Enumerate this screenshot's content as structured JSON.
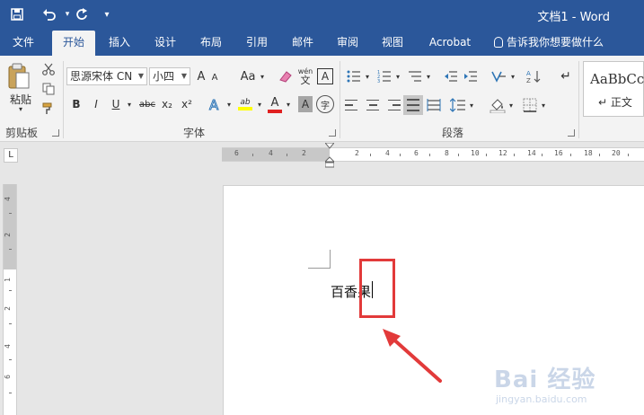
{
  "window": {
    "title": "文档1  -  Word"
  },
  "quick_access": {
    "save_icon": "save-icon",
    "undo_icon": "undo-icon",
    "redo_icon": "redo-icon",
    "customize": "▾"
  },
  "tabs": [
    {
      "label": "文件"
    },
    {
      "label": "开始",
      "active": true
    },
    {
      "label": "插入"
    },
    {
      "label": "设计"
    },
    {
      "label": "布局"
    },
    {
      "label": "引用"
    },
    {
      "label": "邮件"
    },
    {
      "label": "审阅"
    },
    {
      "label": "视图"
    },
    {
      "label": "Acrobat"
    }
  ],
  "tell_me": {
    "label": "告诉我你想要做什么"
  },
  "clipboard": {
    "paste_label": "粘贴",
    "group_label": "剪贴板"
  },
  "font": {
    "name": "思源宋体 CN",
    "size": "小四",
    "group_label": "字体",
    "buttons": {
      "bold": "B",
      "italic": "I",
      "underline": "U",
      "strike": "abc",
      "subscript": "x₂",
      "superscript": "x²",
      "change_case": "Aa",
      "grow": "A",
      "shrink": "A",
      "phonetic": "wén",
      "phonetic_char": "文",
      "char_border": "A",
      "highlight_label": "ab",
      "font_color": "A",
      "char_shading": "A",
      "enclose": "字"
    }
  },
  "paragraph": {
    "group_label": "段落"
  },
  "styles": {
    "sample": "AaBbCcD",
    "name": "↵ 正文"
  },
  "ruler": {
    "h_numbers": [
      "6",
      "4",
      "2",
      "2",
      "4",
      "6",
      "8",
      "10",
      "12",
      "14",
      "16",
      "18",
      "20"
    ],
    "v_numbers": [
      "4",
      "2",
      "1",
      "2",
      "4",
      "6"
    ],
    "tab_selector": "L"
  },
  "document": {
    "text": "百香果"
  },
  "watermark": {
    "brand": "Bai 经验",
    "url": "jingyan.baidu.com"
  },
  "colors": {
    "accent": "#2b579a",
    "annotation": "#e23a3a",
    "highlight": "#ffff00",
    "font_red": "#e02020"
  }
}
